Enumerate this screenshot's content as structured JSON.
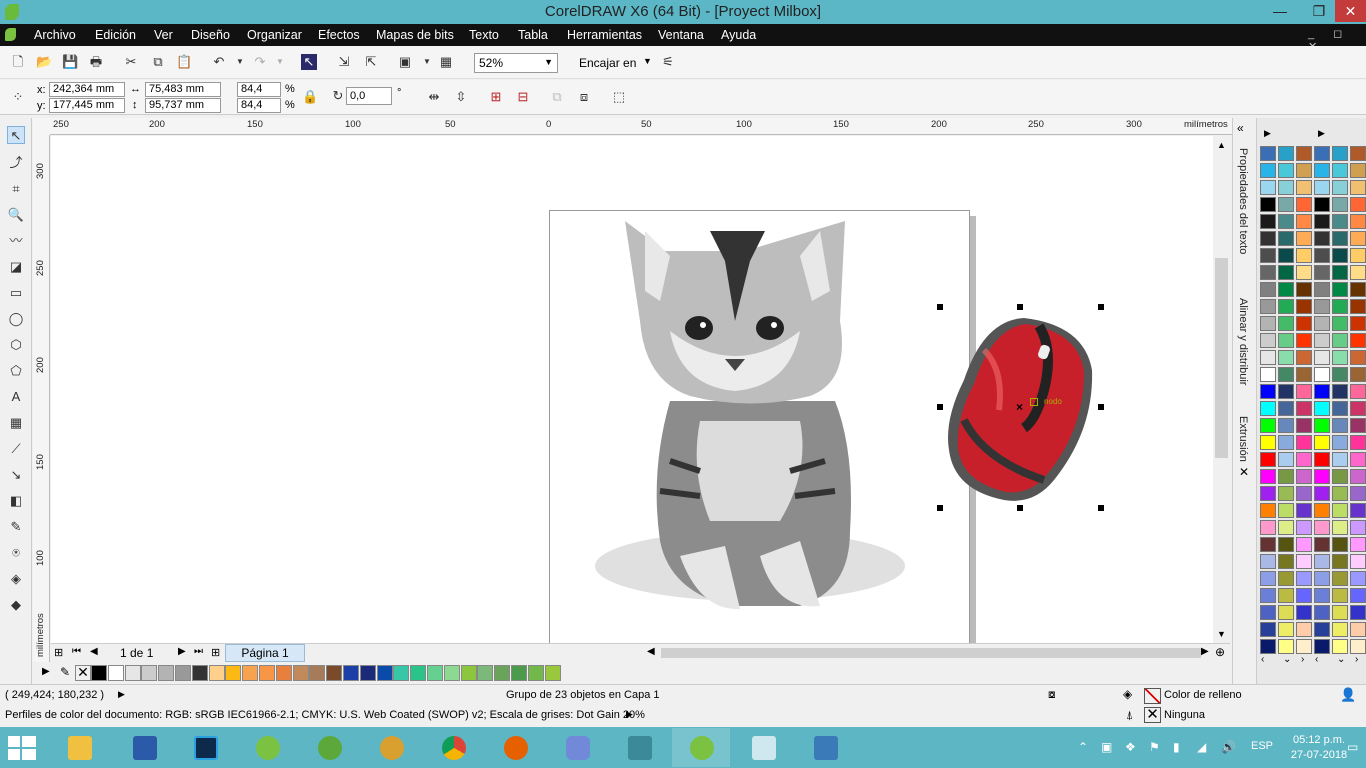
{
  "window": {
    "title": "CorelDRAW X6 (64 Bit) - [Proyect Milbox]",
    "min": "—",
    "max": "❐",
    "close": "✕"
  },
  "menu": [
    "Archivo",
    "Edición",
    "Ver",
    "Diseño",
    "Organizar",
    "Efectos",
    "Mapas de bits",
    "Texto",
    "Tabla",
    "Herramientas",
    "Ventana",
    "Ayuda"
  ],
  "menu_controls": "_ ◻ ✕",
  "toolbar": {
    "zoom": "52%",
    "fit": "Encajar en"
  },
  "props": {
    "x_label": "x:",
    "x": "242,364 mm",
    "y_label": "y:",
    "y": "177,445 mm",
    "w": "75,483 mm",
    "h": "95,737 mm",
    "sx": "84,4",
    "sy": "84,4",
    "pct": "%",
    "angle": "0,0",
    "deg": "°"
  },
  "rulers": {
    "top": [
      "250",
      "200",
      "150",
      "100",
      "50",
      "0",
      "50",
      "100",
      "150",
      "200",
      "250",
      "300"
    ],
    "unit": "milímetros",
    "left": [
      "300",
      "250",
      "200",
      "150",
      "100"
    ]
  },
  "nav": {
    "page_count": "1 de 1",
    "page_tab": "Página 1"
  },
  "canvas_label": "nodo",
  "dockers": [
    "Propiedades del texto",
    "Alinear y distribuir",
    "Extrusión"
  ],
  "status": {
    "coords": "( 249,424; 180,232 )",
    "selection": "Grupo de 23 objetos en Capa 1",
    "fill_label": "Color de relleno",
    "outline_label": "Ninguna",
    "profile": "Perfiles de color del documento: RGB: sRGB IEC61966-2.1; CMYK: U.S. Web Coated (SWOP) v2; Escala de grises: Dot Gain 20%"
  },
  "taskbar": {
    "lang": "ESP",
    "time": "05:12 p.m.",
    "date": "27-07-2018"
  },
  "colors": {
    "bottom_palette": [
      "#000000",
      "#ffffff",
      "#e6e6e6",
      "#cccccc",
      "#b3b3b3",
      "#999999",
      "#333333",
      "#ffd08c",
      "#fdb913",
      "#f7a24f",
      "#f79646",
      "#e97f3d",
      "#c2895b",
      "#a57b5a",
      "#7a4b2a",
      "#1b3fa6",
      "#1b2a7a",
      "#0b4aa8",
      "#38c6a8",
      "#2ac48b",
      "#65d08f",
      "#8ed991",
      "#8cc63f",
      "#7cb87a",
      "#6aa35a",
      "#4c9a4c",
      "#73b84a",
      "#9ac83c"
    ],
    "palette_col1": [
      "#3a6fb5",
      "#28b4e8",
      "#9ad6f0",
      "#000000",
      "#1a1a1a",
      "#333333",
      "#4d4d4d",
      "#666666",
      "#808080",
      "#999999",
      "#b3b3b3",
      "#cccccc",
      "#e6e6e6",
      "#ffffff",
      "#0000ff",
      "#00ffff",
      "#00ff00",
      "#ffff00",
      "#ff0000",
      "#ff00ff",
      "#a020f0",
      "#ff8000",
      "#ff99cc",
      "#663333",
      "#a9b8e6",
      "#8c9ee6",
      "#6b7fd6",
      "#4d62c2",
      "#263f99",
      "#0a1a6b"
    ],
    "palette_col2": [
      "#28a0c8",
      "#48c8d8",
      "#88d0d8",
      "#78a8a8",
      "#4a8a8a",
      "#2a6a6a",
      "#0a4a4a",
      "#006644",
      "#008844",
      "#22aa55",
      "#44bb66",
      "#66cc88",
      "#88ddaa",
      "#448866",
      "#223366",
      "#446699",
      "#6688bb",
      "#88aadd",
      "#aaccee",
      "#779944",
      "#99bb55",
      "#bbdd66",
      "#ddee88",
      "#555511",
      "#777722",
      "#999933",
      "#bbbb44",
      "#dddd55",
      "#eeee66",
      "#ffff88"
    ],
    "palette_col3": [
      "#b05a2a",
      "#d0a050",
      "#f0c070",
      "#ff6633",
      "#ff8844",
      "#ffaa55",
      "#ffcc66",
      "#ffdd88",
      "#663300",
      "#993300",
      "#cc3300",
      "#ff3300",
      "#cc6633",
      "#996633",
      "#ff6699",
      "#cc3366",
      "#993366",
      "#ff3399",
      "#ff66cc",
      "#cc66cc",
      "#9966cc",
      "#6633cc",
      "#cc99ff",
      "#ff99ff",
      "#ffccff",
      "#9999ff",
      "#6666ff",
      "#3333cc",
      "#ffccaa",
      "#ffeecc"
    ]
  }
}
